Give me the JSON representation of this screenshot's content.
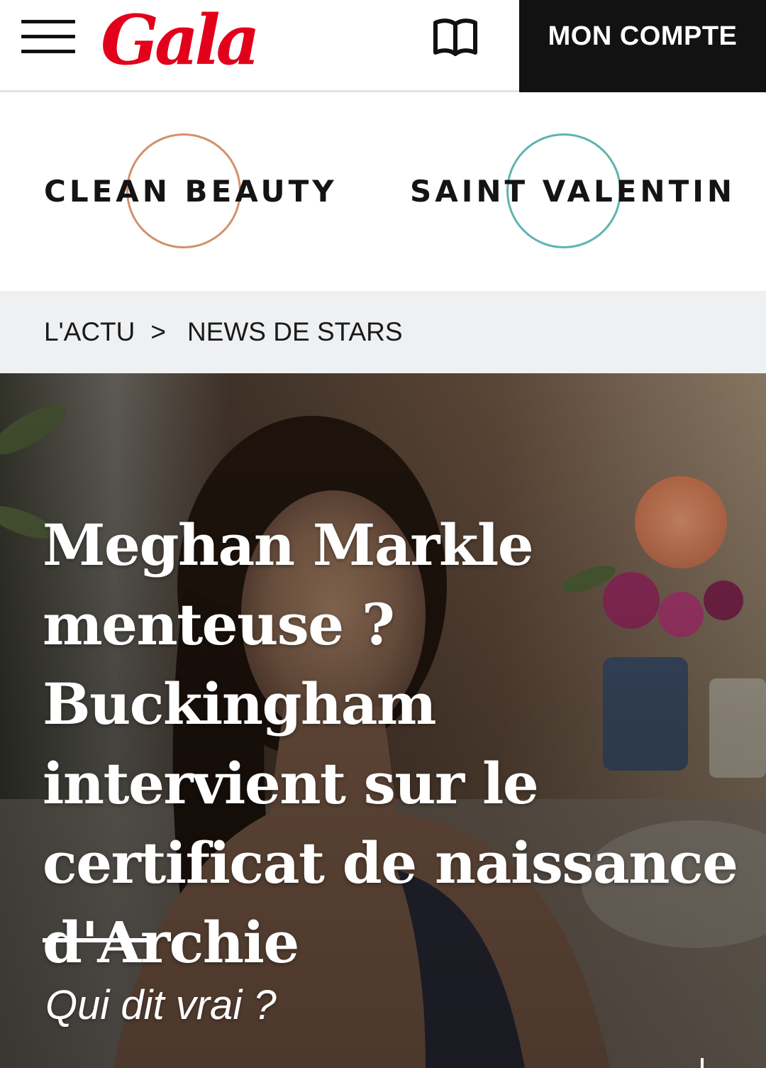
{
  "header": {
    "logo": "Gala",
    "account_label": "MON COMPTE",
    "menu_icon": "hamburger-menu-icon",
    "magazine_icon": "open-book-icon"
  },
  "topics": [
    {
      "label": "CLEAN BEAUTY",
      "ring_color": "#d4906c"
    },
    {
      "label": "SAINT VALENTIN",
      "ring_color": "#5fb3b0"
    }
  ],
  "breadcrumb": {
    "items": [
      "L'ACTU",
      "NEWS DE STARS"
    ],
    "separator": ">"
  },
  "article": {
    "headline": "Meghan Markle menteuse ? Buckingham intervient sur le certificat de naissance d'Archie",
    "subtitle": "Qui dit vrai ?"
  },
  "colors": {
    "brand_red": "#e3001b",
    "account_bg": "#121212",
    "breadcrumb_bg": "#eff0f2"
  }
}
